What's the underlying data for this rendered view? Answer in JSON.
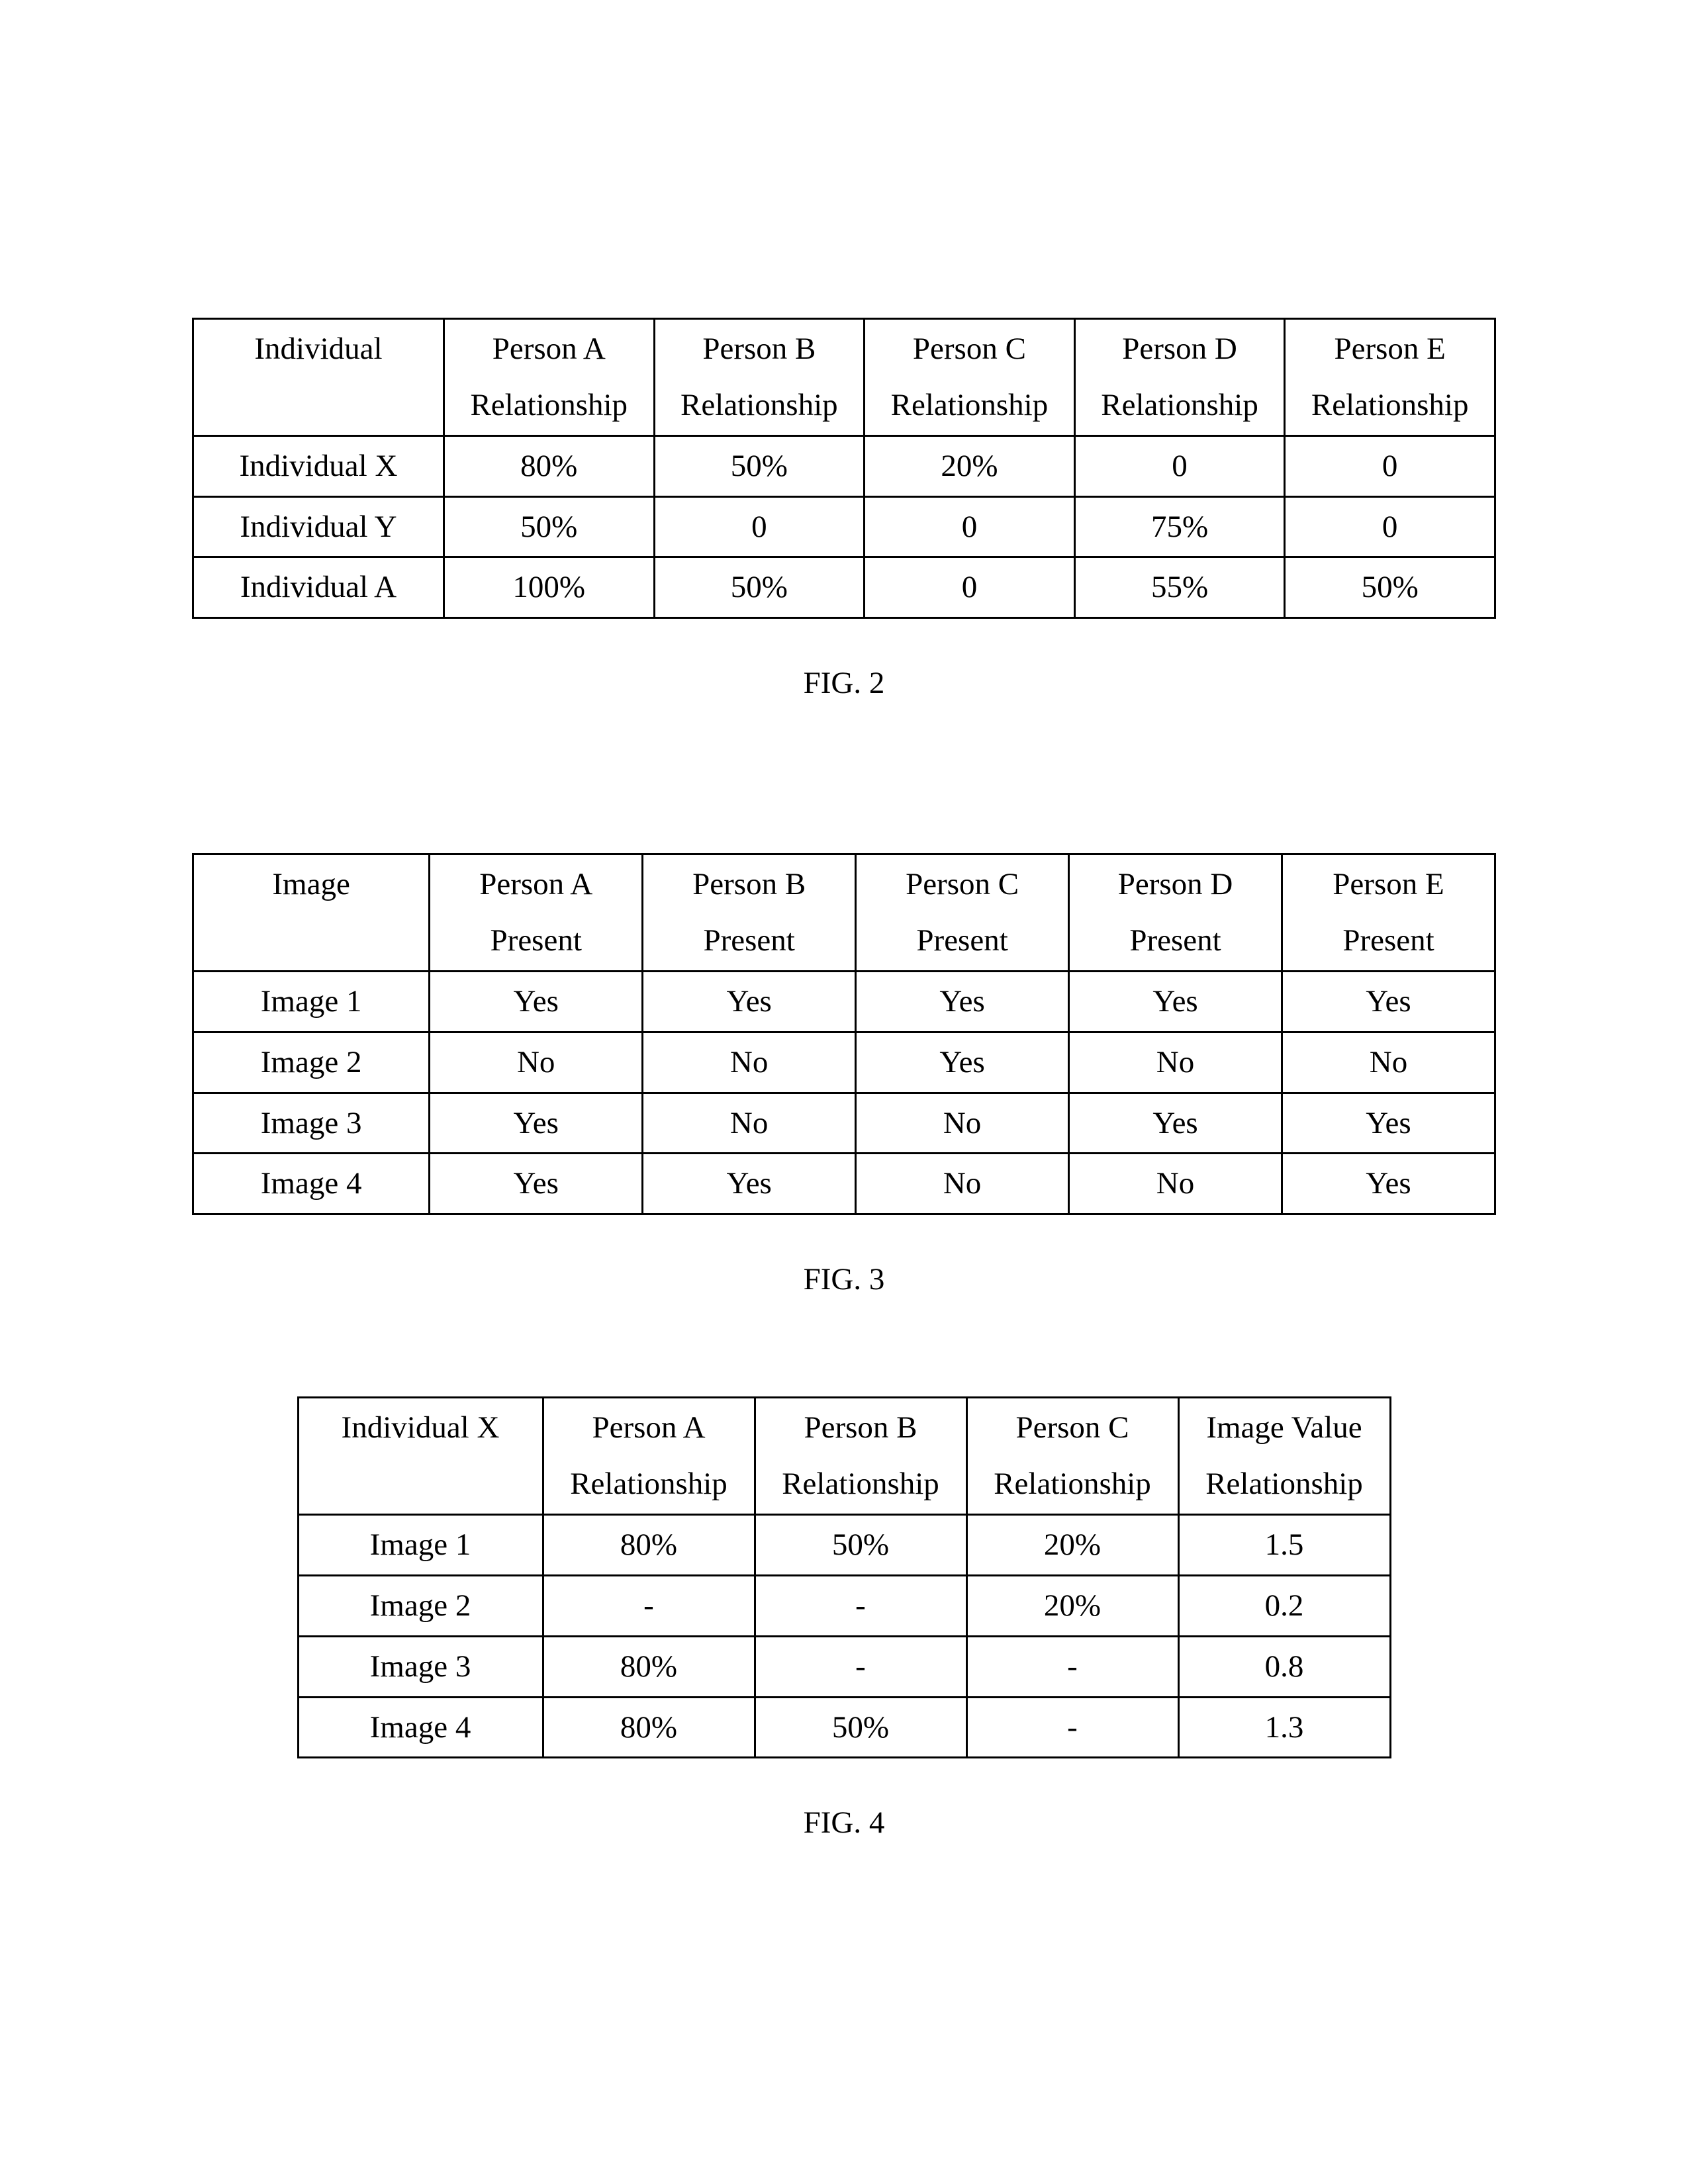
{
  "figure2": {
    "caption": "FIG. 2",
    "headers": {
      "col0": "Individual",
      "cols": [
        {
          "line1": "Person A",
          "line2": "Relationship"
        },
        {
          "line1": "Person B",
          "line2": "Relationship"
        },
        {
          "line1": "Person C",
          "line2": "Relationship"
        },
        {
          "line1": "Person D",
          "line2": "Relationship"
        },
        {
          "line1": "Person E",
          "line2": "Relationship"
        }
      ]
    },
    "rows": [
      {
        "label": "Individual X",
        "cells": [
          "80%",
          "50%",
          "20%",
          "0",
          "0"
        ]
      },
      {
        "label": "Individual Y",
        "cells": [
          "50%",
          "0",
          "0",
          "75%",
          "0"
        ]
      },
      {
        "label": "Individual A",
        "cells": [
          "100%",
          "50%",
          "0",
          "55%",
          "50%"
        ]
      }
    ]
  },
  "figure3": {
    "caption": "FIG. 3",
    "headers": {
      "col0": "Image",
      "cols": [
        {
          "line1": "Person A",
          "line2": "Present"
        },
        {
          "line1": "Person B",
          "line2": "Present"
        },
        {
          "line1": "Person C",
          "line2": "Present"
        },
        {
          "line1": "Person D",
          "line2": "Present"
        },
        {
          "line1": "Person E",
          "line2": "Present"
        }
      ]
    },
    "rows": [
      {
        "label": "Image 1",
        "cells": [
          "Yes",
          "Yes",
          "Yes",
          "Yes",
          "Yes"
        ]
      },
      {
        "label": "Image 2",
        "cells": [
          "No",
          "No",
          "Yes",
          "No",
          "No"
        ]
      },
      {
        "label": "Image 3",
        "cells": [
          "Yes",
          "No",
          "No",
          "Yes",
          "Yes"
        ]
      },
      {
        "label": "Image 4",
        "cells": [
          "Yes",
          "Yes",
          "No",
          "No",
          "Yes"
        ]
      }
    ]
  },
  "figure4": {
    "caption": "FIG. 4",
    "headers": {
      "col0": "Individual X",
      "cols": [
        {
          "line1": "Person A",
          "line2": "Relationship"
        },
        {
          "line1": "Person B",
          "line2": "Relationship"
        },
        {
          "line1": "Person C",
          "line2": "Relationship"
        },
        {
          "line1": "Image Value",
          "line2": "Relationship"
        }
      ]
    },
    "rows": [
      {
        "label": "Image 1",
        "cells": [
          "80%",
          "50%",
          "20%",
          "1.5"
        ]
      },
      {
        "label": "Image 2",
        "cells": [
          "-",
          "-",
          "20%",
          "0.2"
        ]
      },
      {
        "label": "Image 3",
        "cells": [
          "80%",
          "-",
          "-",
          "0.8"
        ]
      },
      {
        "label": "Image 4",
        "cells": [
          "80%",
          "50%",
          "-",
          "1.3"
        ]
      }
    ]
  }
}
